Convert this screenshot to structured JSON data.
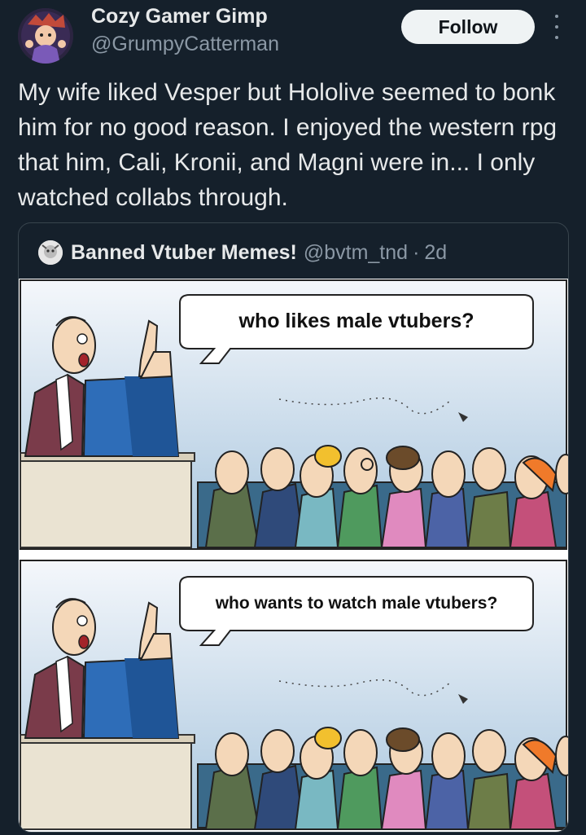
{
  "author": {
    "display_name": "Cozy Gamer Gimp",
    "handle": "@GrumpyCatterman"
  },
  "actions": {
    "follow_label": "Follow",
    "more_icon": "more-vertical-icon"
  },
  "tweet": {
    "text": "My wife liked Vesper but Hololive seemed to bonk him for no good reason. I enjoyed the western rpg that him, Cali, Kronii, and Magni were in... I only watched collabs through."
  },
  "quote": {
    "display_name": "Banned Vtuber Memes!",
    "handle": "@bvtm_tnd",
    "separator": "·",
    "time": "2d",
    "comic": {
      "panel1_speech": "who likes male vtubers?",
      "panel2_speech": "who wants to watch male vtubers?"
    }
  },
  "colors": {
    "background": "#15202b",
    "text_primary": "#e7e9ea",
    "text_secondary": "#8b98a5",
    "follow_bg": "#eff3f4"
  }
}
